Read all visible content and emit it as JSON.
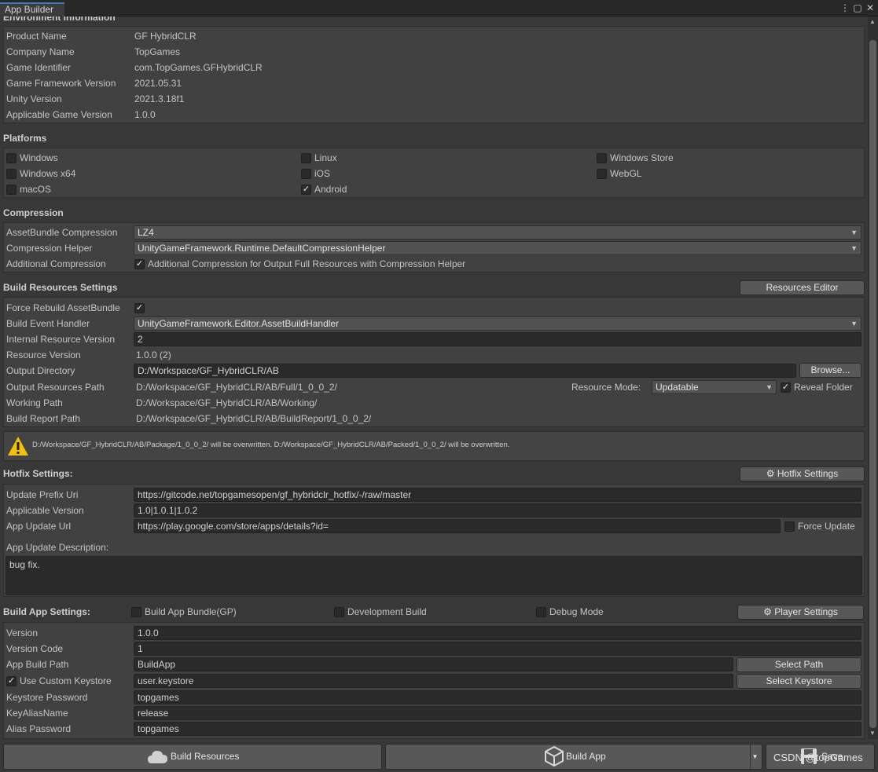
{
  "window": {
    "tab_title": "App Builder",
    "menu_glyph": "⋮",
    "maximize_glyph": "▢",
    "close_glyph": "✕"
  },
  "env": {
    "section_title": "Environment Information",
    "rows": [
      {
        "label": "Product Name",
        "value": "GF HybridCLR"
      },
      {
        "label": "Company Name",
        "value": "TopGames"
      },
      {
        "label": "Game Identifier",
        "value": "com.TopGames.GFHybridCLR"
      },
      {
        "label": "Game Framework Version",
        "value": "2021.05.31"
      },
      {
        "label": "Unity Version",
        "value": "2021.3.18f1"
      },
      {
        "label": "Applicable Game Version",
        "value": "1.0.0"
      }
    ]
  },
  "platforms": {
    "section_title": "Platforms",
    "items": [
      {
        "label": "Windows",
        "checked": false
      },
      {
        "label": "Linux",
        "checked": false
      },
      {
        "label": "Windows Store",
        "checked": false
      },
      {
        "label": "Windows x64",
        "checked": false
      },
      {
        "label": "iOS",
        "checked": false
      },
      {
        "label": "WebGL",
        "checked": false
      },
      {
        "label": "macOS",
        "checked": false
      },
      {
        "label": "Android",
        "checked": true
      }
    ]
  },
  "compression": {
    "section_title": "Compression",
    "assetbundle_label": "AssetBundle Compression",
    "assetbundle_value": "LZ4",
    "helper_label": "Compression Helper",
    "helper_value": "UnityGameFramework.Runtime.DefaultCompressionHelper",
    "additional_label": "Additional Compression",
    "additional_text": "Additional Compression for Output Full Resources with Compression Helper",
    "additional_checked": true
  },
  "build_resources": {
    "section_title": "Build Resources Settings",
    "editor_button": "Resources Editor",
    "force_rebuild_label": "Force Rebuild AssetBundle",
    "force_rebuild_checked": true,
    "event_handler_label": "Build Event Handler",
    "event_handler_value": "UnityGameFramework.Editor.AssetBuildHandler",
    "internal_version_label": "Internal Resource Version",
    "internal_version_value": "2",
    "resource_version_label": "Resource Version",
    "resource_version_value": "1.0.0 (2)",
    "output_dir_label": "Output Directory",
    "output_dir_value": "D:/Workspace/GF_HybridCLR/AB",
    "browse_button": "Browse...",
    "output_path_label": "Output Resources Path",
    "output_path_value": "D:/Workspace/GF_HybridCLR/AB/Full/1_0_0_2/",
    "resource_mode_label": "Resource Mode:",
    "resource_mode_value": "Updatable",
    "reveal_folder_label": "Reveal Folder",
    "reveal_folder_checked": true,
    "working_path_label": "Working Path",
    "working_path_value": "D:/Workspace/GF_HybridCLR/AB/Working/",
    "report_path_label": "Build Report Path",
    "report_path_value": "D:/Workspace/GF_HybridCLR/AB/BuildReport/1_0_0_2/",
    "warning_text": "D:/Workspace/GF_HybridCLR/AB/Package/1_0_0_2/ will be overwritten. D:/Workspace/GF_HybridCLR/AB/Packed/1_0_0_2/ will be overwritten."
  },
  "hotfix": {
    "section_title": "Hotfix Settings:",
    "settings_button": "Hotfix Settings",
    "prefix_label": "Update Prefix Uri",
    "prefix_value": "https://gitcode.net/topgamesopen/gf_hybridclr_hotfix/-/raw/master",
    "applicable_label": "Applicable Version",
    "applicable_value": "1.0|1.0.1|1.0.2",
    "app_url_label": "App Update Url",
    "app_url_value": "https://play.google.com/store/apps/details?id=",
    "force_update_label": "Force Update",
    "force_update_checked": false,
    "description_label": "App Update Description:",
    "description_value": "bug fix."
  },
  "build_app": {
    "section_title": "Build App Settings:",
    "bundle_label": "Build App Bundle(GP)",
    "bundle_checked": false,
    "dev_label": "Development Build",
    "dev_checked": false,
    "debug_label": "Debug Mode",
    "debug_checked": false,
    "player_button": "Player Settings",
    "version_label": "Version",
    "version_value": "1.0.0",
    "code_label": "Version Code",
    "code_value": "1",
    "path_label": "App Build Path",
    "path_value": "BuildApp",
    "select_path_button": "Select Path",
    "keystore_label": "Use Custom Keystore",
    "keystore_checked": true,
    "keystore_value": "user.keystore",
    "select_keystore_button": "Select Keystore",
    "ks_password_label": "Keystore Password",
    "ks_password_value": "topgames",
    "alias_label": "KeyAliasName",
    "alias_value": "release",
    "alias_password_label": "Alias Password",
    "alias_password_value": "topgames"
  },
  "footer": {
    "build_resources_button": "Build Resources",
    "build_app_button": "Build App",
    "save_button": "Save",
    "watermark": "CSDN @topGames"
  }
}
